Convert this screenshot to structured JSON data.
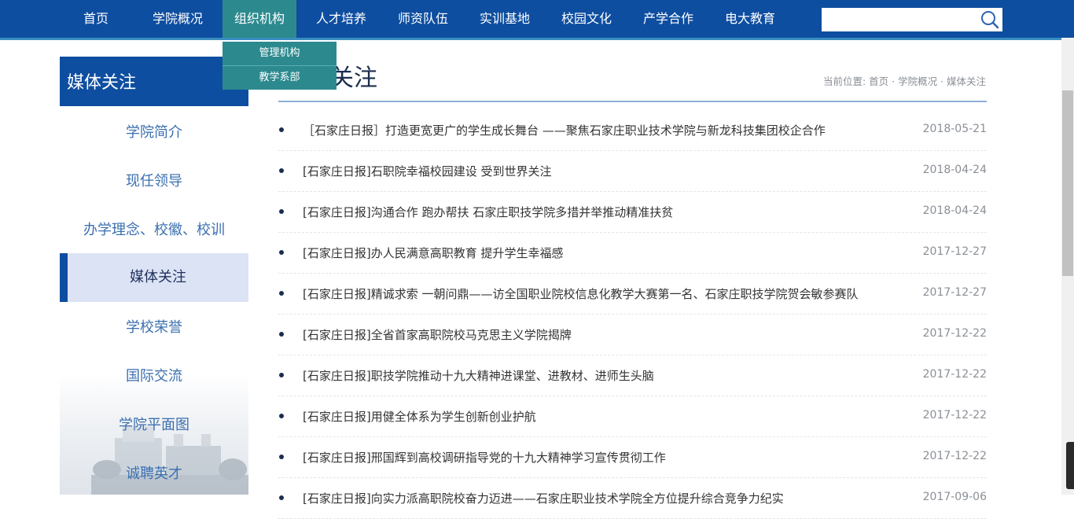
{
  "nav": {
    "items": [
      {
        "label": "首页"
      },
      {
        "label": "学院概况"
      },
      {
        "label": "组织机构"
      },
      {
        "label": "人才培养"
      },
      {
        "label": "师资队伍"
      },
      {
        "label": "实训基地"
      },
      {
        "label": "校园文化"
      },
      {
        "label": "产学合作"
      },
      {
        "label": "电大教育"
      }
    ],
    "active_index": 2,
    "search": {
      "placeholder": "",
      "value": ""
    }
  },
  "dropdown": {
    "items": [
      {
        "label": "管理机构"
      },
      {
        "label": "教学系部"
      }
    ]
  },
  "sidebar": {
    "title": "媒体关注",
    "items": [
      {
        "label": "学院简介"
      },
      {
        "label": "现任领导"
      },
      {
        "label": "办学理念、校徽、校训"
      },
      {
        "label": "媒体关注"
      },
      {
        "label": "学校荣誉"
      },
      {
        "label": "国际交流"
      },
      {
        "label": "学院平面图"
      },
      {
        "label": "诚聘英才"
      }
    ],
    "active_index": 3
  },
  "main": {
    "title": "关注",
    "breadcrumb": "当前位置: 首页 · 学院概况 · 媒体关注",
    "news": [
      {
        "title": "［石家庄日报］打造更宽更广的学生成长舞台 ——聚焦石家庄职业技术学院与新龙科技集团校企合作",
        "date": "2018-05-21"
      },
      {
        "title": "[石家庄日报]石职院幸福校园建设 受到世界关注",
        "date": "2018-04-24"
      },
      {
        "title": "[石家庄日报]沟通合作 跑办帮扶 石家庄职技学院多措并举推动精准扶贫",
        "date": "2018-04-24"
      },
      {
        "title": "[石家庄日报]办人民满意高职教育 提升学生幸福感",
        "date": "2017-12-27"
      },
      {
        "title": "[石家庄日报]精诚求索 一朝问鼎——访全国职业院校信息化教学大赛第一名、石家庄职技学院贺会敏参赛队",
        "date": "2017-12-27"
      },
      {
        "title": "[石家庄日报]全省首家高职院校马克思主义学院揭牌",
        "date": "2017-12-22"
      },
      {
        "title": "[石家庄日报]职技学院推动十九大精神进课堂、进教材、进师生头脑",
        "date": "2017-12-22"
      },
      {
        "title": "[石家庄日报]用健全体系为学生创新创业护航",
        "date": "2017-12-22"
      },
      {
        "title": "[石家庄日报]邢国辉到高校调研指导党的十九大精神学习宣传贯彻工作",
        "date": "2017-12-22"
      },
      {
        "title": "[石家庄日报]向实力派高职院校奋力迈进——石家庄职业技术学院全方位提升综合竞争力纪实",
        "date": "2017-09-06"
      }
    ]
  },
  "colors": {
    "nav_bg": "#0e4ea0",
    "nav_active": "#2c8a8f",
    "sidebar_active_bg": "#dbe3f5",
    "sidebar_link": "#3b6fb0"
  }
}
